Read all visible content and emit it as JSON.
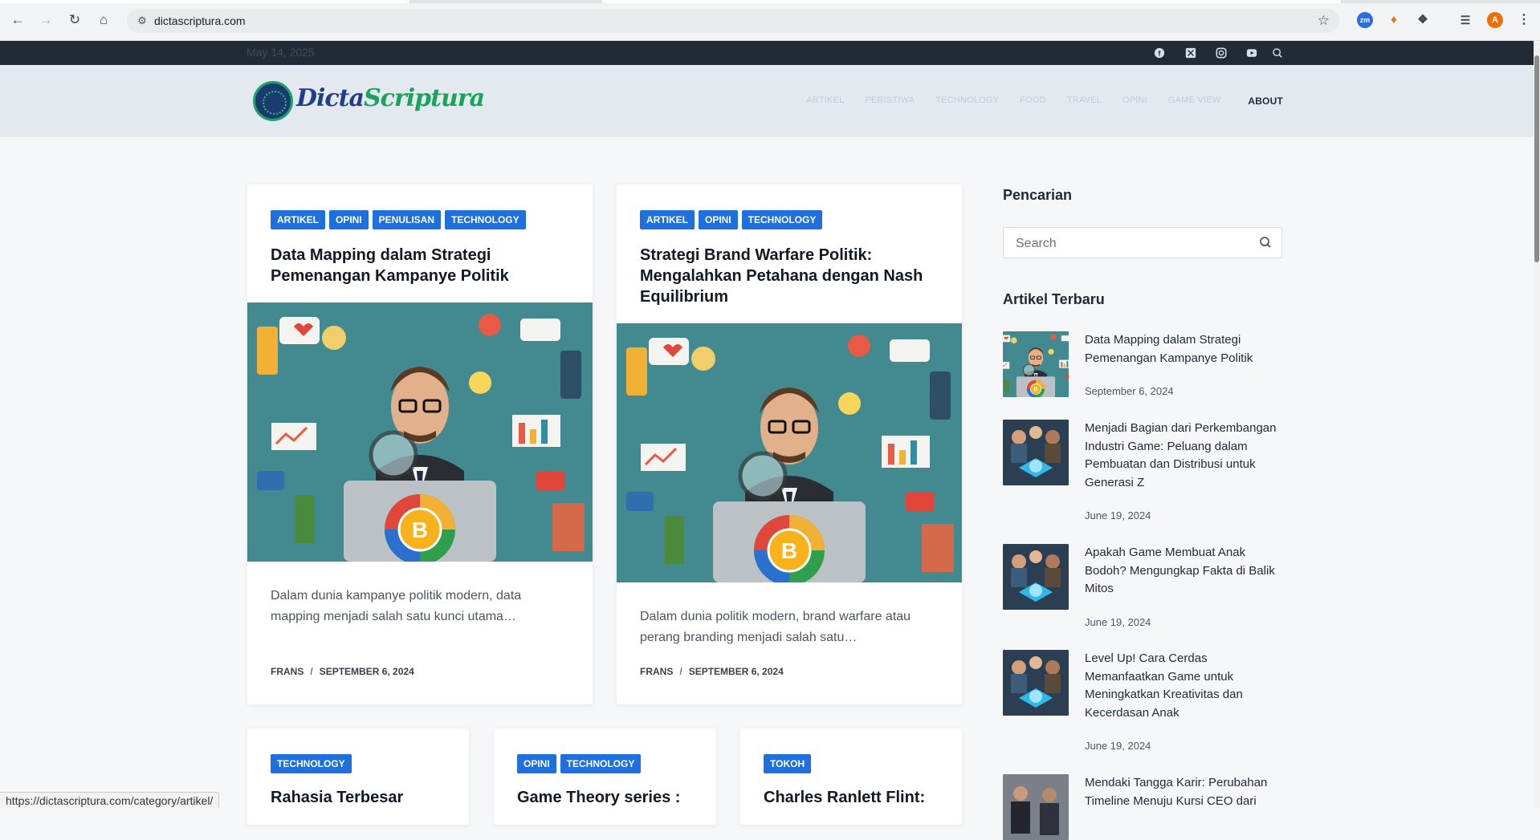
{
  "browser": {
    "url": "dictascriptura.com",
    "profile_initial": "A",
    "ext_zoom_label": "zm",
    "status_url": "https://dictascriptura.com/category/artikel/"
  },
  "topbar": {
    "date": "May 14, 2025",
    "social_icons": [
      "facebook-icon",
      "x-twitter-icon",
      "instagram-icon",
      "youtube-icon",
      "search-icon"
    ]
  },
  "header": {
    "logo_text_1": "Dicta",
    "logo_text_2": "Scriptura",
    "menu": [
      "ARTIKEL",
      "PERISTIWA",
      "TECHNOLOGY",
      "FOOD",
      "TRAVEL",
      "OPINI",
      "GAME VIEW"
    ],
    "menu_active": "ABOUT"
  },
  "posts": [
    {
      "categories": [
        "ARTIKEL",
        "OPINI",
        "PENULISAN",
        "TECHNOLOGY"
      ],
      "title": "Data Mapping dalam Strategi Pemenangan Kampanye Politik",
      "excerpt": "Dalam dunia kampanye politik modern, data mapping menjadi salah satu kunci utama…",
      "author": "FRANS",
      "date": "SEPTEMBER 6, 2024"
    },
    {
      "categories": [
        "ARTIKEL",
        "OPINI",
        "TECHNOLOGY"
      ],
      "title": "Strategi Brand Warfare Politik: Mengalahkan Petahana dengan Nash Equilibrium",
      "excerpt": "Dalam dunia politik modern, brand warfare atau perang branding menjadi salah satu…",
      "author": "FRANS",
      "date": "SEPTEMBER 6, 2024"
    }
  ],
  "posts_row2": [
    {
      "categories": [
        "TECHNOLOGY"
      ],
      "title": "Rahasia Terbesar"
    },
    {
      "categories": [
        "OPINI",
        "TECHNOLOGY"
      ],
      "title": "Game Theory series :"
    },
    {
      "categories": [
        "TOKOH"
      ],
      "title": "Charles Ranlett Flint:"
    }
  ],
  "sidebar": {
    "search_heading": "Pencarian",
    "search_placeholder": "Search",
    "recent_heading": "Artikel Terbaru",
    "recent": [
      {
        "title": "Data Mapping dalam Strategi Pemenangan Kampanye Politik",
        "date": "September 6, 2024"
      },
      {
        "title": "Menjadi Bagian dari Perkembangan Industri Game: Peluang dalam Pembuatan dan Distribusi untuk Generasi Z",
        "date": "June 19, 2024"
      },
      {
        "title": "Apakah Game Membuat Anak Bodoh? Mengungkap Fakta di Balik Mitos",
        "date": "June 19, 2024"
      },
      {
        "title": "Level Up! Cara Cerdas Memanfaatkan Game untuk Meningkatkan Kreativitas dan Kecerdasan Anak",
        "date": "June 19, 2024"
      },
      {
        "title": "Mendaki Tangga Karir: Perubahan Timeline Menuju Kursi CEO dari",
        "date": ""
      }
    ]
  },
  "colors": {
    "accent": "#1f6fdc",
    "topbar": "#212b36",
    "header": "#e3e9ef"
  }
}
